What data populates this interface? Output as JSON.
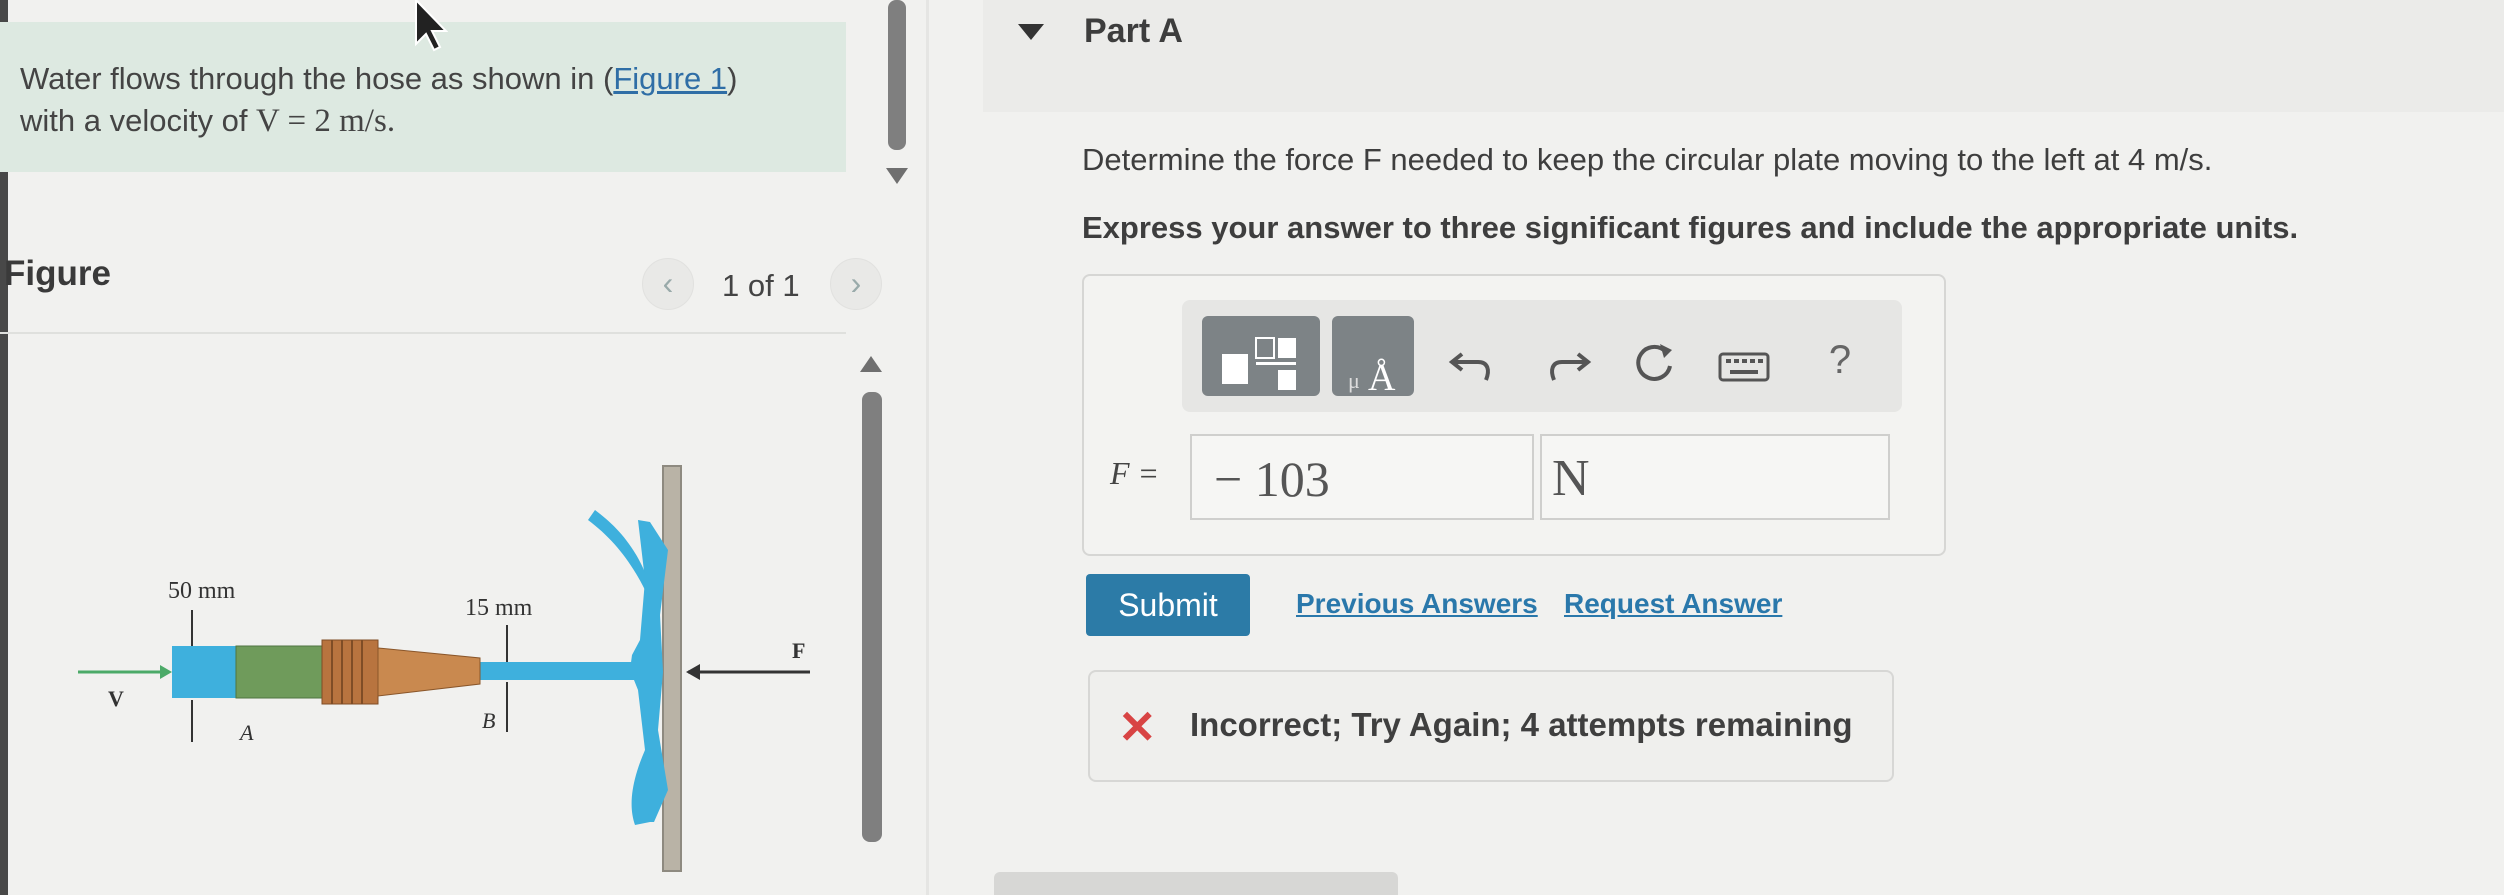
{
  "problem": {
    "text_before": "Water flows through the hose as shown in (",
    "figure_link": "Figure 1",
    "text_after": ")",
    "line2_prefix": "with a velocity of ",
    "velocity_math": "V = 2 m/s."
  },
  "figure": {
    "title": "Figure",
    "counter": "1 of 1",
    "prev_icon": "chevron-left",
    "next_icon": "chevron-right",
    "labels": {
      "dia_a": "50 mm",
      "dia_b": "15 mm",
      "v": "V",
      "a": "A",
      "b": "B",
      "f": "F"
    }
  },
  "part": {
    "title": "Part A",
    "instruction": "Determine the force F needed to keep the circular plate moving to the left at 4 m/s.",
    "instruction_bold": "Express your answer to three significant figures and include the appropriate units."
  },
  "toolbar": {
    "help": "?"
  },
  "answer": {
    "label": "F =",
    "value": "− 103",
    "unit": "N"
  },
  "actions": {
    "submit": "Submit",
    "previous_answers": "Previous Answers",
    "request_answer": "Request Answer"
  },
  "feedback": {
    "text": "Incorrect; Try Again; 4 attempts remaining"
  },
  "colors": {
    "submit": "#2c7ba7",
    "link": "#2a78ab",
    "error": "#d84444",
    "water": "#3eb0dd"
  }
}
